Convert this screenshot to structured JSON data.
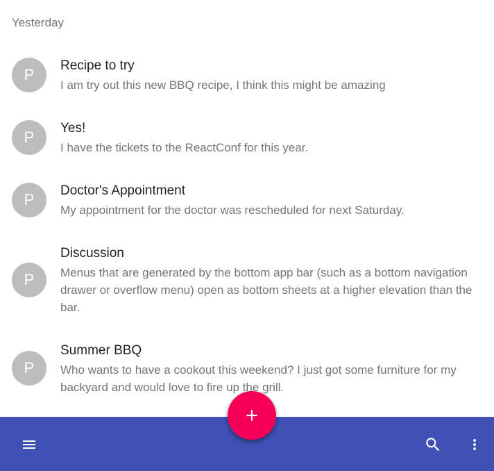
{
  "list": {
    "subheader": "Yesterday",
    "items": [
      {
        "avatar": "P",
        "primary": "Recipe to try",
        "secondary": "I am try out this new BBQ recipe, I think this might be amazing"
      },
      {
        "avatar": "P",
        "primary": "Yes!",
        "secondary": "I have the tickets to the ReactConf for this year."
      },
      {
        "avatar": "P",
        "primary": "Doctor's Appointment",
        "secondary": "My appointment for the doctor was rescheduled for next Saturday."
      },
      {
        "avatar": "P",
        "primary": "Discussion",
        "secondary": "Menus that are generated by the bottom app bar (such as a bottom navigation drawer or overflow menu) open as bottom sheets at a higher elevation than the bar."
      },
      {
        "avatar": "P",
        "primary": "Summer BBQ",
        "secondary": "Who wants to have a cookout this weekend? I just got some furniture for my backyard and would love to fire up the grill."
      }
    ]
  },
  "app_bar": {
    "menu_icon": "menu-icon",
    "fab_icon": "add-icon",
    "search_icon": "search-icon",
    "more_icon": "more-vert-icon",
    "colors": {
      "bar": "#3f51b5",
      "fab": "#f50057",
      "avatar": "#bdbdbd"
    }
  }
}
